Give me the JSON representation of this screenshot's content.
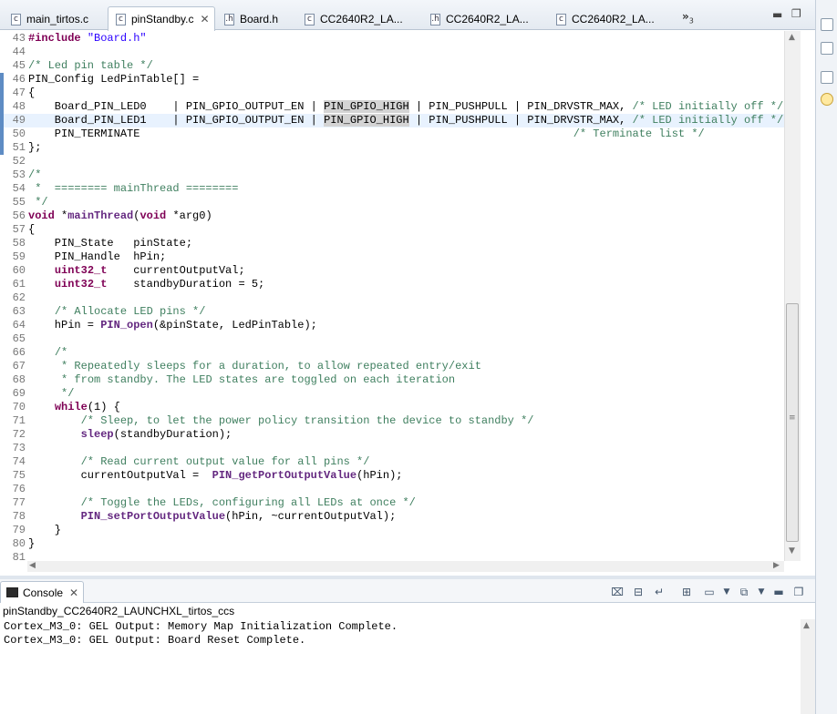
{
  "editor_tabs": [
    {
      "label": "main_tirtos.c",
      "icon": "c-file-icon",
      "glyph": "c",
      "active": false
    },
    {
      "label": "pinStandby.c",
      "icon": "c-file-icon",
      "glyph": "c",
      "active": true
    },
    {
      "label": "Board.h",
      "icon": "h-file-icon",
      "glyph": ".h",
      "active": false
    },
    {
      "label": "CC2640R2_LA...",
      "icon": "c-file-icon",
      "glyph": "c",
      "active": false
    },
    {
      "label": "CC2640R2_LA...",
      "icon": "h-file-icon",
      "glyph": ".h",
      "active": false
    },
    {
      "label": "CC2640R2_LA...",
      "icon": "c-file-icon",
      "glyph": "c",
      "active": false
    }
  ],
  "tab_overflow": {
    "label": "»",
    "count": "3"
  },
  "code": {
    "lines": [
      {
        "n": "43",
        "text": "#include \"Board.h\""
      },
      {
        "n": "44",
        "text": ""
      },
      {
        "n": "45",
        "text": "/* Led pin table */"
      },
      {
        "n": "46",
        "text": "PIN_Config LedPinTable[] ="
      },
      {
        "n": "47",
        "text": "{"
      },
      {
        "n": "48",
        "text": "    Board_PIN_LED0    | PIN_GPIO_OUTPUT_EN | PIN_GPIO_HIGH | PIN_PUSHPULL | PIN_DRVSTR_MAX, /* LED initially off */"
      },
      {
        "n": "49",
        "text": "    Board_PIN_LED1    | PIN_GPIO_OUTPUT_EN | PIN_GPIO_HIGH | PIN_PUSHPULL | PIN_DRVSTR_MAX, /* LED initially off */"
      },
      {
        "n": "50",
        "text": "    PIN_TERMINATE                                                                  /* Terminate list */"
      },
      {
        "n": "51",
        "text": "};"
      },
      {
        "n": "52",
        "text": ""
      },
      {
        "n": "53",
        "text": "/*"
      },
      {
        "n": "54",
        "text": " *  ======== mainThread ========"
      },
      {
        "n": "55",
        "text": " */"
      },
      {
        "n": "56",
        "text": "void *mainThread(void *arg0)"
      },
      {
        "n": "57",
        "text": "{"
      },
      {
        "n": "58",
        "text": "    PIN_State   pinState;"
      },
      {
        "n": "59",
        "text": "    PIN_Handle  hPin;"
      },
      {
        "n": "60",
        "text": "    uint32_t    currentOutputVal;"
      },
      {
        "n": "61",
        "text": "    uint32_t    standbyDuration = 5;"
      },
      {
        "n": "62",
        "text": ""
      },
      {
        "n": "63",
        "text": "    /* Allocate LED pins */"
      },
      {
        "n": "64",
        "text": "    hPin = PIN_open(&pinState, LedPinTable);"
      },
      {
        "n": "65",
        "text": ""
      },
      {
        "n": "66",
        "text": "    /*"
      },
      {
        "n": "67",
        "text": "     * Repeatedly sleeps for a duration, to allow repeated entry/exit"
      },
      {
        "n": "68",
        "text": "     * from standby. The LED states are toggled on each iteration"
      },
      {
        "n": "69",
        "text": "     */"
      },
      {
        "n": "70",
        "text": "    while(1) {"
      },
      {
        "n": "71",
        "text": "        /* Sleep, to let the power policy transition the device to standby */"
      },
      {
        "n": "72",
        "text": "        sleep(standbyDuration);"
      },
      {
        "n": "73",
        "text": ""
      },
      {
        "n": "74",
        "text": "        /* Read current output value for all pins */"
      },
      {
        "n": "75",
        "text": "        currentOutputVal =  PIN_getPortOutputValue(hPin);"
      },
      {
        "n": "76",
        "text": ""
      },
      {
        "n": "77",
        "text": "        /* Toggle the LEDs, configuring all LEDs at once */"
      },
      {
        "n": "78",
        "text": "        PIN_setPortOutputValue(hPin, ~currentOutputVal);"
      },
      {
        "n": "79",
        "text": "    }"
      },
      {
        "n": "80",
        "text": "}"
      },
      {
        "n": "81",
        "text": ""
      }
    ],
    "highlighted_line": "49"
  },
  "console": {
    "tab_label": "Console",
    "process_name": "pinStandby_CC2640R2_LAUNCHXL_tirtos_ccs",
    "output": [
      "Cortex_M3_0: GEL Output: Memory Map Initialization Complete.",
      "Cortex_M3_0: GEL Output: Board Reset Complete."
    ]
  },
  "colors": {
    "keyword": "#7f0055",
    "comment": "#3f7f5f",
    "string": "#2a00ff",
    "current_line": "#e8f2fe"
  }
}
